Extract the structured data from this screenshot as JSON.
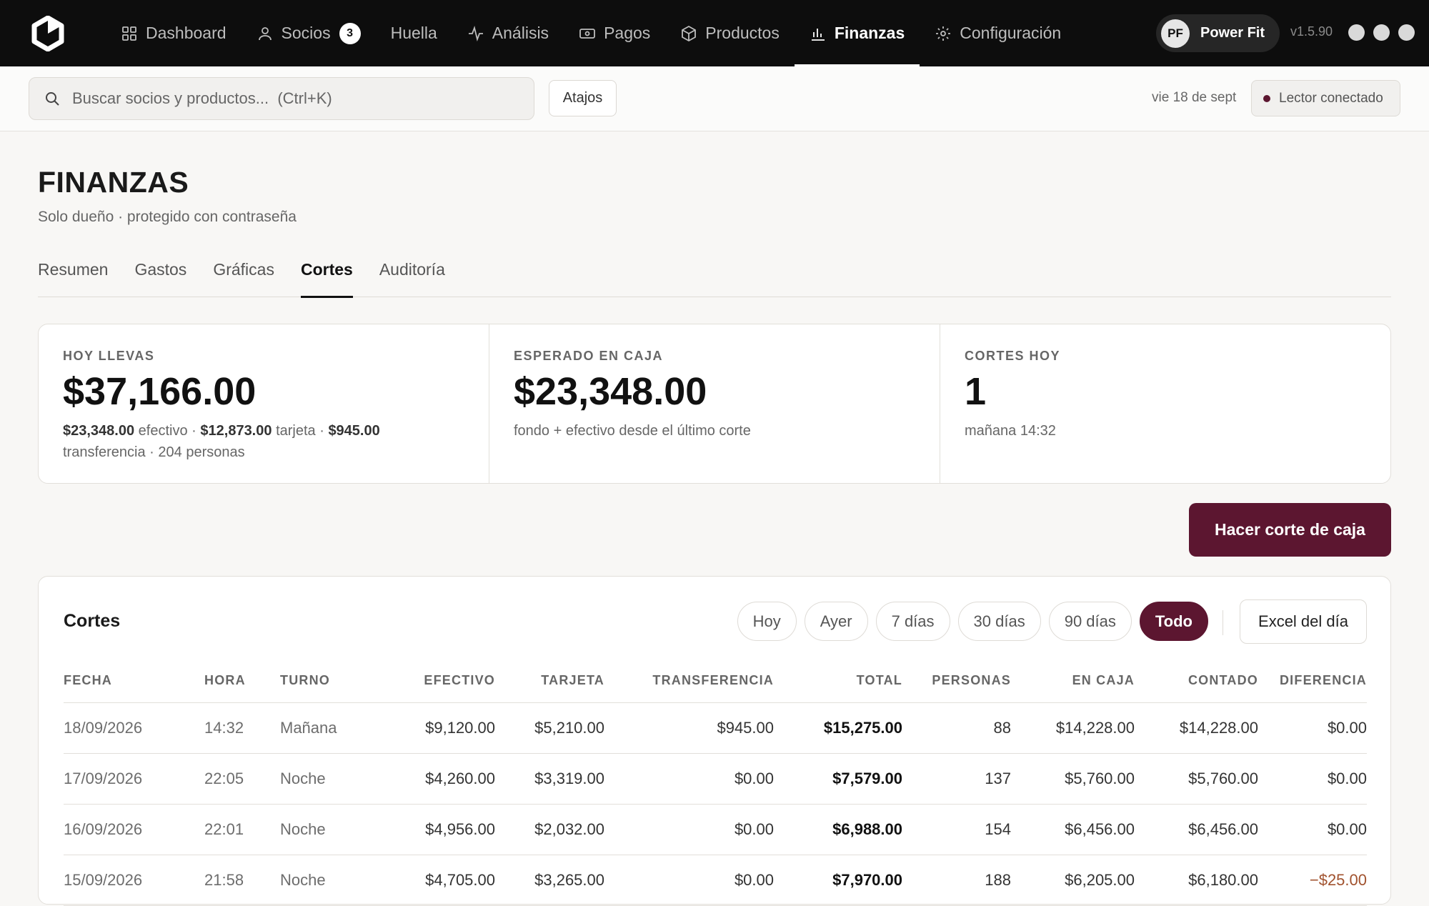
{
  "nav": {
    "items": [
      {
        "label": "Dashboard",
        "icon": "grid-icon"
      },
      {
        "label": "Socios",
        "icon": "user-icon",
        "badge": "3"
      },
      {
        "label": "Huella",
        "icon": ""
      },
      {
        "label": "Análisis",
        "icon": "activity-icon"
      },
      {
        "label": "Pagos",
        "icon": "banknote-icon"
      },
      {
        "label": "Productos",
        "icon": "box-icon"
      },
      {
        "label": "Finanzas",
        "icon": "bar-chart-icon",
        "active": true
      },
      {
        "label": "Configuración",
        "icon": "gear-icon"
      }
    ],
    "profile": {
      "initials": "PF",
      "name": "Power Fit"
    },
    "version": "v1.5.90"
  },
  "toolbar": {
    "search_placeholder": "Buscar socios y productos...  (Ctrl+K)",
    "shortcuts_label": "Atajos",
    "date": "vie 18 de sept",
    "reader_status": "Lector conectado"
  },
  "page": {
    "title": "FINANZAS",
    "subtitle": "Solo dueño · protegido con contraseña",
    "tabs": [
      "Resumen",
      "Gastos",
      "Gráficas",
      "Cortes",
      "Auditoría"
    ],
    "active_tab": "Cortes"
  },
  "stats": {
    "today": {
      "label": "HOY LLEVAS",
      "value": "$37,166.00",
      "cash": "$23,348.00",
      "cash_label": "efectivo",
      "card": "$12,873.00",
      "card_label": "tarjeta",
      "transfer": "$945.00",
      "transfer_label": "transferencia",
      "people": "204 personas"
    },
    "expected": {
      "label": "ESPERADO EN CAJA",
      "value": "$23,348.00",
      "desc": "fondo + efectivo desde el último corte"
    },
    "cuts": {
      "label": "CORTES HOY",
      "value": "1",
      "desc": "mañana 14:32"
    }
  },
  "actions": {
    "make_cut": "Hacer corte de caja"
  },
  "cortes": {
    "title": "Cortes",
    "filters": [
      "Hoy",
      "Ayer",
      "7 días",
      "30 días",
      "90 días",
      "Todo"
    ],
    "active_filter": "Todo",
    "excel_label": "Excel del día",
    "columns": [
      "FECHA",
      "HORA",
      "TURNO",
      "EFECTIVO",
      "TARJETA",
      "TRANSFERENCIA",
      "TOTAL",
      "PERSONAS",
      "EN CAJA",
      "CONTADO",
      "DIFERENCIA"
    ],
    "rows": [
      [
        "18/09/2026",
        "14:32",
        "Mañana",
        "$9,120.00",
        "$5,210.00",
        "$945.00",
        "$15,275.00",
        "88",
        "$14,228.00",
        "$14,228.00",
        "$0.00"
      ],
      [
        "17/09/2026",
        "22:05",
        "Noche",
        "$4,260.00",
        "$3,319.00",
        "$0.00",
        "$7,579.00",
        "137",
        "$5,760.00",
        "$5,760.00",
        "$0.00"
      ],
      [
        "16/09/2026",
        "22:01",
        "Noche",
        "$4,956.00",
        "$2,032.00",
        "$0.00",
        "$6,988.00",
        "154",
        "$6,456.00",
        "$6,456.00",
        "$0.00"
      ],
      [
        "15/09/2026",
        "21:58",
        "Noche",
        "$4,705.00",
        "$3,265.00",
        "$0.00",
        "$7,970.00",
        "188",
        "$6,205.00",
        "$6,180.00",
        "−$25.00"
      ]
    ]
  },
  "colors": {
    "accent": "#5c1630",
    "nav_bg": "#0d0d0d",
    "negative": "#a1522e"
  }
}
